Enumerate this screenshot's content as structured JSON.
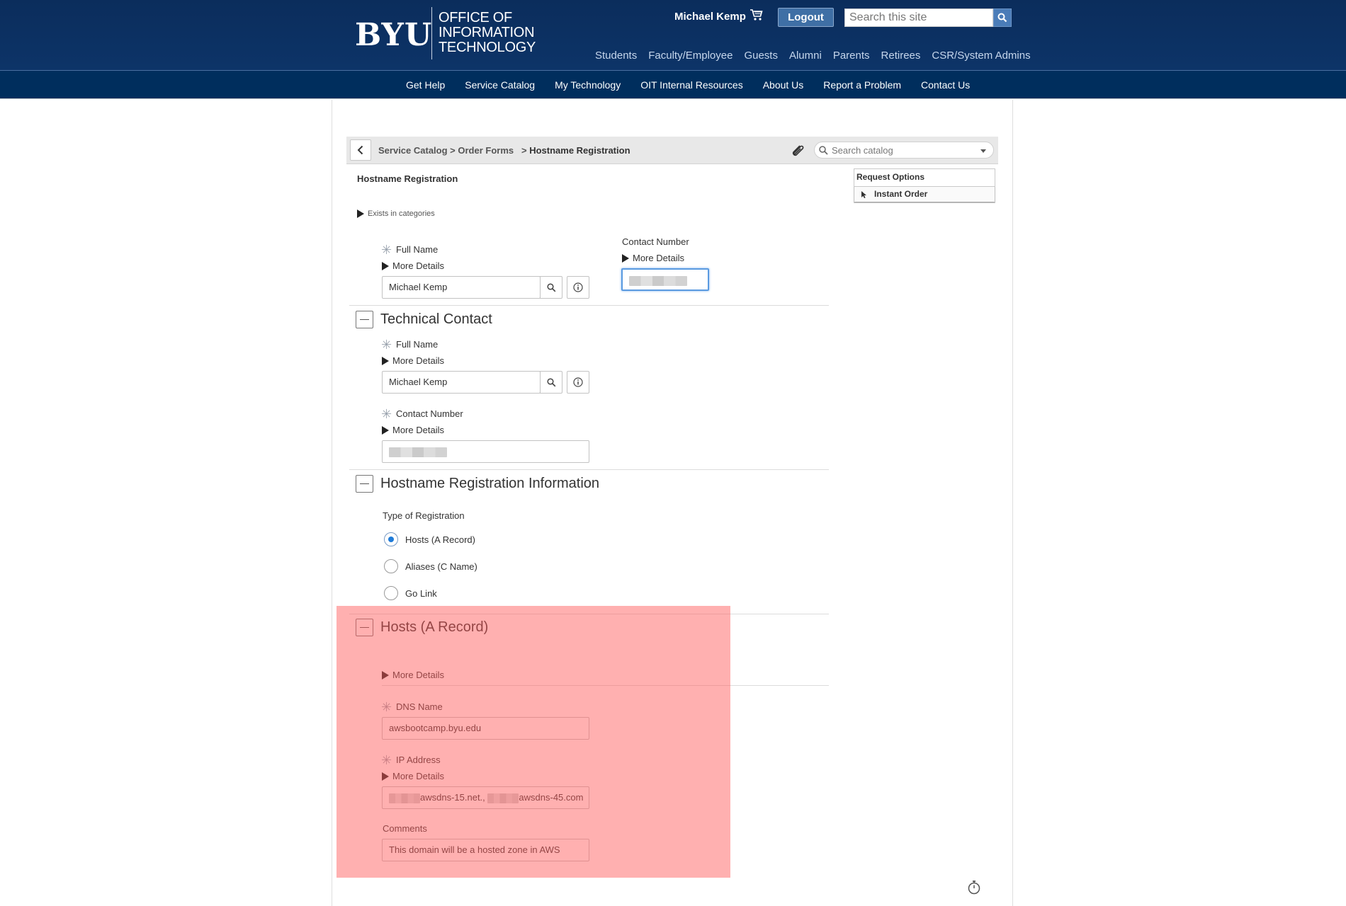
{
  "header": {
    "logo": "BYU",
    "org_title_lines": [
      "Office of",
      "Information",
      "Technology"
    ],
    "user_name": "Michael Kemp",
    "logout_label": "Logout",
    "search_placeholder": "Search this site",
    "audience_links": [
      "Students",
      "Faculty/Employee",
      "Guests",
      "Alumni",
      "Parents",
      "Retirees",
      "CSR/System Admins"
    ]
  },
  "main_nav": [
    "Get Help",
    "Service Catalog",
    "My Technology",
    "OIT Internal Resources",
    "About Us",
    "Report a Problem",
    "Contact Us"
  ],
  "catalog_bar": {
    "breadcrumb": [
      "Service Catalog",
      "Order Forms",
      "Hostname Registration"
    ],
    "search_placeholder": "Search catalog"
  },
  "page": {
    "title": "Hostname Registration",
    "categories_label": "Exists in categories"
  },
  "request_options": {
    "header": "Request Options",
    "item": "Instant Order"
  },
  "requester": {
    "full_name_label": "Full Name",
    "more_details": "More Details",
    "full_name_value": "Michael Kemp",
    "contact_number_label": "Contact Number",
    "contact_more_details": "More Details"
  },
  "technical_contact": {
    "heading": "Technical Contact",
    "full_name_label": "Full Name",
    "more_details": "More Details",
    "full_name_value": "Michael Kemp",
    "contact_number_label": "Contact Number",
    "contact_more_details": "More Details"
  },
  "registration_info": {
    "heading": "Hostname Registration Information",
    "type_label": "Type of Registration",
    "options": [
      "Hosts (A Record)",
      "Aliases (C Name)",
      "Go Link"
    ],
    "selected": "Hosts (A Record)"
  },
  "hosts_record": {
    "heading": "Hosts (A Record)",
    "more_details": "More Details",
    "dns_label": "DNS Name",
    "dns_value": "awsbootcamp.byu.edu",
    "ip_label": "IP Address",
    "ip_more_details": "More Details",
    "ip_value_part1": "awsdns-15.net.,",
    "ip_value_part2": "awsdns-45.com",
    "comments_label": "Comments",
    "comments_value": "This domain will be a hosted zone in AWS"
  },
  "colors": {
    "header_bg": "#002e5d",
    "nav_bg": "#002e5d",
    "logout_bg": "#3f6fa5",
    "highlight": "rgba(255,90,90,0.48)",
    "radio_selected": "#1e7bd9"
  }
}
